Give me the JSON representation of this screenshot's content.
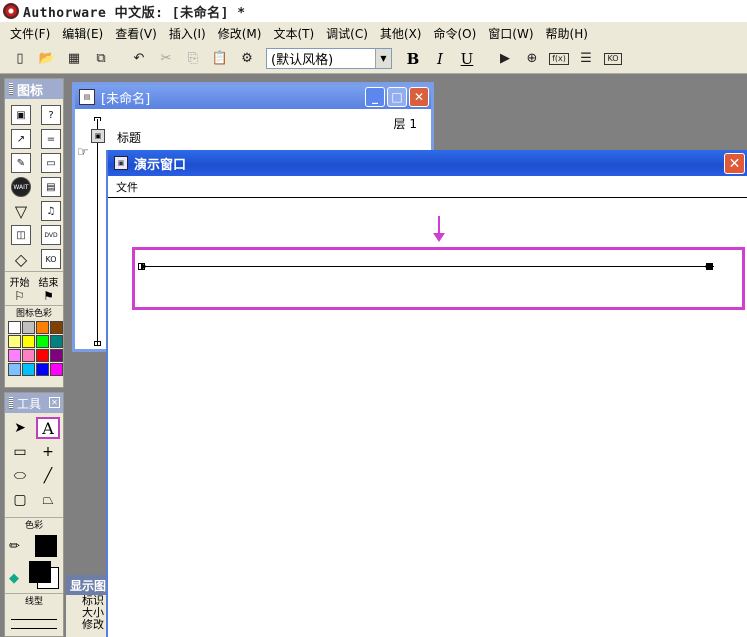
{
  "app": {
    "title": "Authorware 中文版: [未命名] *"
  },
  "menu": [
    "文件(F)",
    "编辑(E)",
    "查看(V)",
    "插入(I)",
    "修改(M)",
    "文本(T)",
    "调试(C)",
    "其他(X)",
    "命令(O)",
    "窗口(W)",
    "帮助(H)"
  ],
  "toolbar": {
    "style_value": "(默认风格)",
    "bold": "B",
    "italic": "I",
    "underline": "U",
    "fn_label": "f(x)",
    "ko_label": "KO"
  },
  "icons_palette": {
    "title": "图标",
    "start_label": "开始",
    "end_label": "结束",
    "color_label": "图标色彩",
    "wait_label": "WAIT",
    "dvd_label": "DVD",
    "ko_label": "KO",
    "swatches": [
      "#ffffff",
      "#c0c0c0",
      "#ff8000",
      "#804000",
      "#ffff80",
      "#ffff00",
      "#00ff00",
      "#008080",
      "#ff80ff",
      "#ff80c0",
      "#ff0000",
      "#800080",
      "#80c0ff",
      "#00c0ff",
      "#0000ff",
      "#ff00ff"
    ]
  },
  "tools_palette": {
    "title": "工具",
    "text_tool": "A",
    "color_label": "色彩",
    "line_label": "线型"
  },
  "flowline_window": {
    "title": "[未命名]",
    "level": "层 1",
    "icon_label": "标题"
  },
  "presentation_window": {
    "title": "演示窗口",
    "menu_file": "文件"
  },
  "properties": {
    "title": "显示图",
    "rows": [
      "标识",
      "大小",
      "修改"
    ]
  },
  "colors": {
    "highlight": "#d040d0",
    "titlebar_blue": "#2f6be9"
  }
}
